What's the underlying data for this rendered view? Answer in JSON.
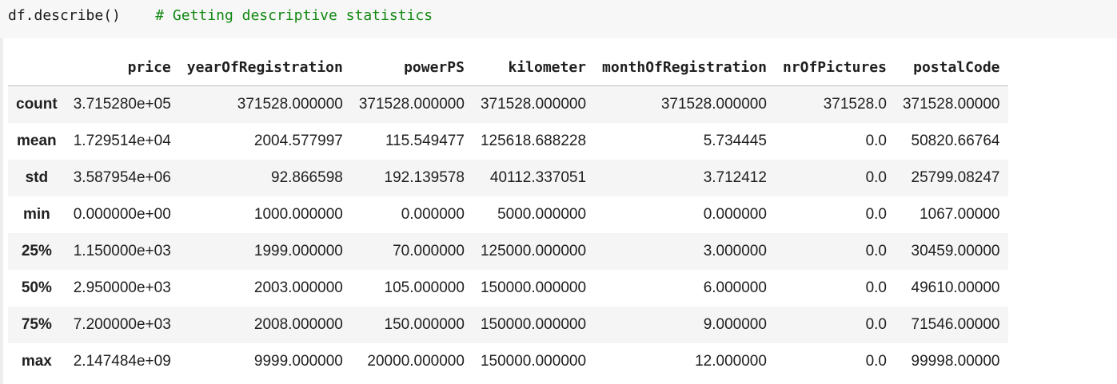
{
  "code": {
    "text": "df.describe()",
    "comment": "# Getting descriptive statistics"
  },
  "table": {
    "columns": [
      "price",
      "yearOfRegistration",
      "powerPS",
      "kilometer",
      "monthOfRegistration",
      "nrOfPictures",
      "postalCode"
    ],
    "rows": [
      {
        "label": "count",
        "values": [
          "3.715280e+05",
          "371528.000000",
          "371528.000000",
          "371528.000000",
          "371528.000000",
          "371528.0",
          "371528.00000"
        ]
      },
      {
        "label": "mean",
        "values": [
          "1.729514e+04",
          "2004.577997",
          "115.549477",
          "125618.688228",
          "5.734445",
          "0.0",
          "50820.66764"
        ]
      },
      {
        "label": "std",
        "values": [
          "3.587954e+06",
          "92.866598",
          "192.139578",
          "40112.337051",
          "3.712412",
          "0.0",
          "25799.08247"
        ]
      },
      {
        "label": "min",
        "values": [
          "0.000000e+00",
          "1000.000000",
          "0.000000",
          "5000.000000",
          "0.000000",
          "0.0",
          "1067.00000"
        ]
      },
      {
        "label": "25%",
        "values": [
          "1.150000e+03",
          "1999.000000",
          "70.000000",
          "125000.000000",
          "3.000000",
          "0.0",
          "30459.00000"
        ]
      },
      {
        "label": "50%",
        "values": [
          "2.950000e+03",
          "2003.000000",
          "105.000000",
          "150000.000000",
          "6.000000",
          "0.0",
          "49610.00000"
        ]
      },
      {
        "label": "75%",
        "values": [
          "7.200000e+03",
          "2008.000000",
          "150.000000",
          "150000.000000",
          "9.000000",
          "0.0",
          "71546.00000"
        ]
      },
      {
        "label": "max",
        "values": [
          "2.147484e+09",
          "9999.000000",
          "20000.000000",
          "150000.000000",
          "12.000000",
          "0.0",
          "99998.00000"
        ]
      }
    ]
  }
}
